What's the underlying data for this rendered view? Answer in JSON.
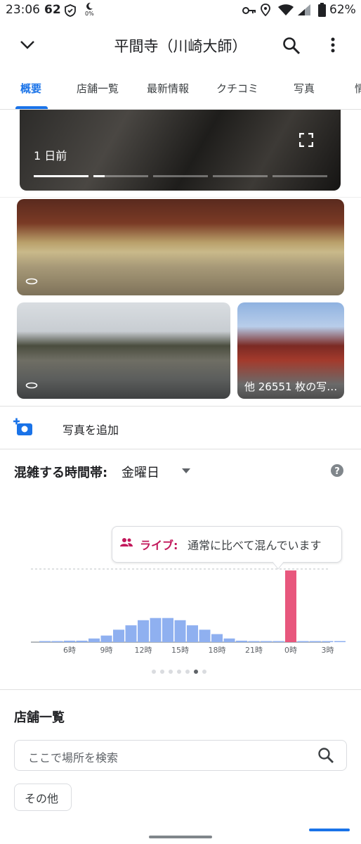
{
  "status_bar": {
    "time": "23:06",
    "notif_count": "62",
    "battery": "62%",
    "small_pct": "0%"
  },
  "header": {
    "title": "平間寺（川崎大師）"
  },
  "tabs": [
    {
      "label": "概要"
    },
    {
      "label": "店舗一覧"
    },
    {
      "label": "最新情報"
    },
    {
      "label": "クチコミ"
    },
    {
      "label": "写真"
    },
    {
      "label": "情"
    }
  ],
  "photos": {
    "story_time": "1 日前",
    "more_photos": "他 26551 枚の写…"
  },
  "add_photo": {
    "label": "写真を追加"
  },
  "popular_times": {
    "title": "混雑する時間帯:",
    "day": "金曜日",
    "live_label": "ライブ:",
    "live_text": "通常に比べて混んでいます",
    "accent": "#e8577d",
    "bar_color": "#8fb0f0",
    "carousel_active": 5
  },
  "chart_data": {
    "type": "bar",
    "categories": [
      "4時",
      "5時",
      "6時",
      "7時",
      "8時",
      "9時",
      "10時",
      "11時",
      "12時",
      "13時",
      "14時",
      "15時",
      "16時",
      "17時",
      "18時",
      "19時",
      "20時",
      "21時",
      "22時",
      "23時",
      "0時",
      "1時",
      "2時",
      "3時",
      "4時"
    ],
    "tick_labels": [
      "6時",
      "9時",
      "12時",
      "15時",
      "18時",
      "21時",
      "0時",
      "3時"
    ],
    "values": [
      0,
      1,
      2,
      2,
      5,
      9,
      17,
      23,
      30,
      33,
      33,
      30,
      23,
      17,
      11,
      5,
      2,
      1,
      1,
      1,
      1,
      1,
      1,
      1,
      0
    ],
    "live_value": 98,
    "live_index": 20,
    "ylim": [
      0,
      100
    ]
  },
  "stores": {
    "title": "店舗一覧",
    "search_placeholder": "ここで場所を検索",
    "other_label": "その他"
  }
}
